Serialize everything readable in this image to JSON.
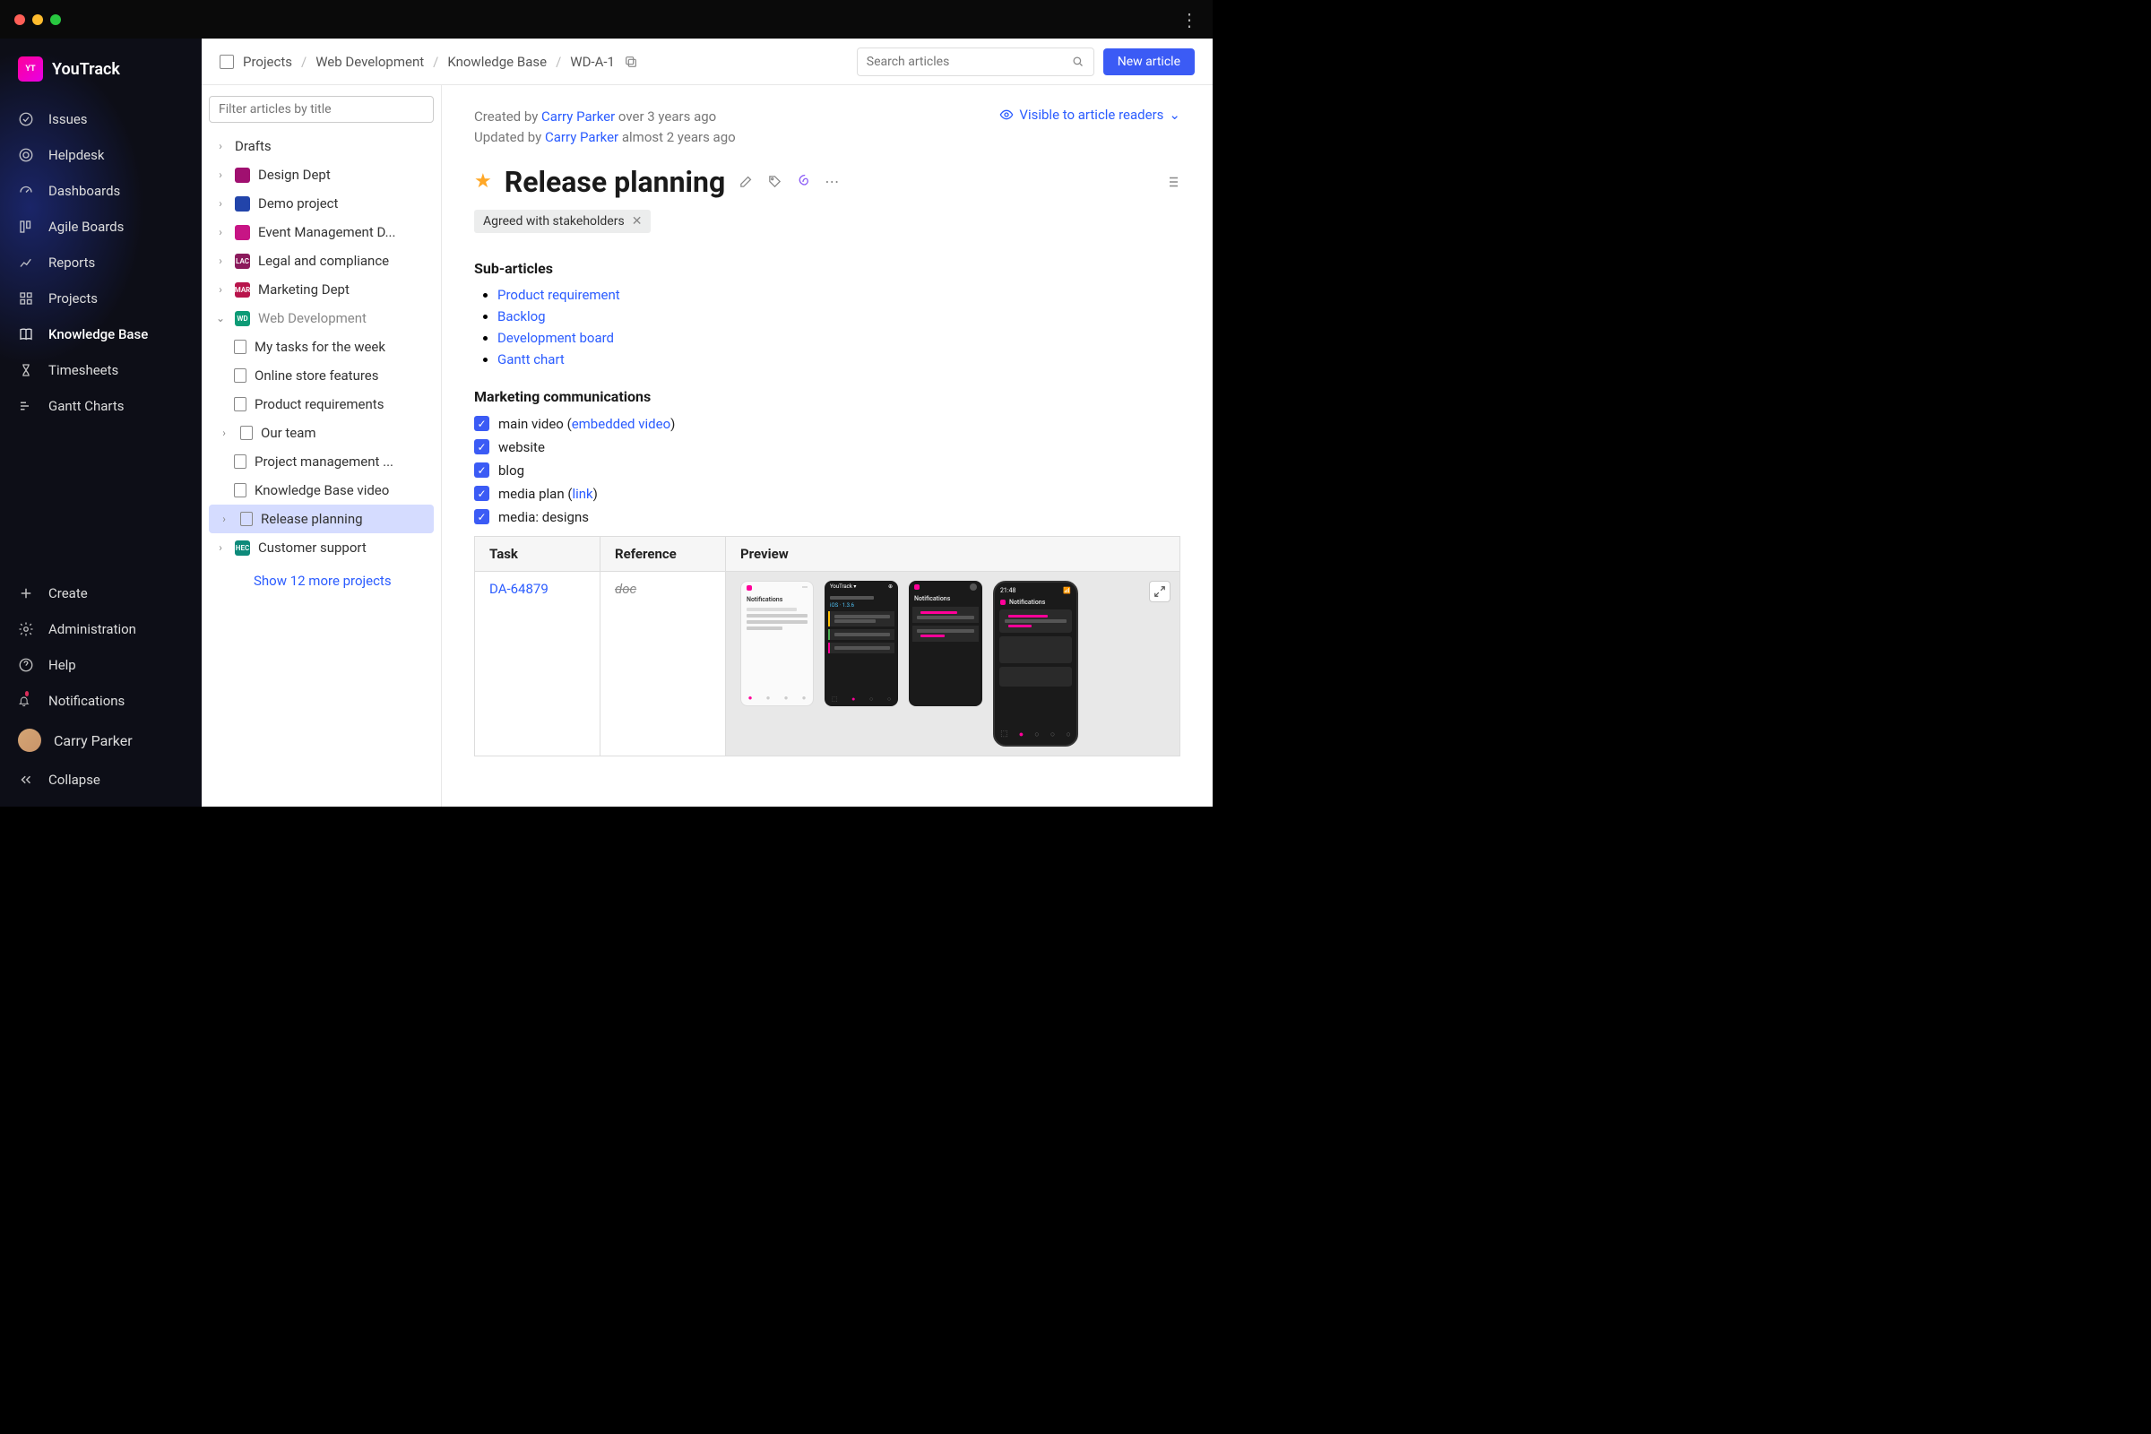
{
  "app": {
    "name": "YouTrack",
    "logo_badge": "YT"
  },
  "sidebar": {
    "items": [
      {
        "label": "Issues",
        "icon": "check-circle"
      },
      {
        "label": "Helpdesk",
        "icon": "lifebuoy"
      },
      {
        "label": "Dashboards",
        "icon": "speedometer"
      },
      {
        "label": "Agile Boards",
        "icon": "board"
      },
      {
        "label": "Reports",
        "icon": "chart-line"
      },
      {
        "label": "Projects",
        "icon": "grid"
      },
      {
        "label": "Knowledge Base",
        "icon": "book",
        "active": true
      },
      {
        "label": "Timesheets",
        "icon": "hourglass"
      },
      {
        "label": "Gantt Charts",
        "icon": "gantt"
      }
    ],
    "bottom": [
      {
        "label": "Create",
        "icon": "plus"
      },
      {
        "label": "Administration",
        "icon": "gear"
      },
      {
        "label": "Help",
        "icon": "question"
      },
      {
        "label": "Notifications",
        "icon": "bell",
        "dot": true
      }
    ],
    "user": {
      "name": "Carry Parker"
    },
    "collapse": "Collapse"
  },
  "breadcrumb": {
    "items": [
      "Projects",
      "Web Development",
      "Knowledge Base",
      "WD-A-1"
    ]
  },
  "search": {
    "placeholder": "Search articles"
  },
  "new_article_btn": "New article",
  "tree": {
    "filter_placeholder": "Filter articles by title",
    "items": [
      {
        "label": "Drafts",
        "type": "folder"
      },
      {
        "label": "Design Dept",
        "type": "project",
        "color": "#a01070"
      },
      {
        "label": "Demo project",
        "type": "project",
        "color": "#2244aa"
      },
      {
        "label": "Event Management D...",
        "type": "project",
        "color": "#c71585"
      },
      {
        "label": "Legal and compliance",
        "type": "project",
        "color": "#8b1a5c",
        "badge": "LAC"
      },
      {
        "label": "Marketing Dept",
        "type": "project",
        "color": "#b8144b",
        "badge": "MAR"
      },
      {
        "label": "Web Development",
        "type": "project",
        "color": "#0d9b76",
        "badge": "WD",
        "expanded": true,
        "muted": true
      },
      {
        "label": "My tasks for the week",
        "type": "doc",
        "child": true
      },
      {
        "label": "Online store features",
        "type": "doc",
        "child": true
      },
      {
        "label": "Product requirements",
        "type": "doc",
        "child": true
      },
      {
        "label": "Our team",
        "type": "doc",
        "child": true,
        "haschev": true
      },
      {
        "label": "Project management ...",
        "type": "doc",
        "child": true,
        "locked": true
      },
      {
        "label": "Knowledge Base video",
        "type": "doc",
        "child": true
      },
      {
        "label": "Release planning",
        "type": "doc",
        "child": true,
        "selected": true,
        "haschev": true
      },
      {
        "label": "Customer support",
        "type": "project",
        "color": "#0d8a7a",
        "badge": "HEC"
      }
    ],
    "show_more": "Show 12 more projects"
  },
  "article": {
    "created_prefix": "Created by ",
    "created_by": "Carry Parker",
    "created_ago": " over 3 years ago",
    "updated_prefix": "Updated by ",
    "updated_by": "Carry Parker",
    "updated_ago": " almost 2 years ago",
    "visibility": "Visible to article readers",
    "title": "Release planning",
    "tag": "Agreed with stakeholders",
    "sub_heading": "Sub-articles",
    "sub_articles": [
      "Product requirement",
      "Backlog",
      "Development board",
      "Gantt chart"
    ],
    "marketing_heading": "Marketing communications",
    "checklist": [
      {
        "text_before": "main video (",
        "link": "embedded video",
        "text_after": ")"
      },
      {
        "text_before": "website"
      },
      {
        "text_before": "blog"
      },
      {
        "text_before": "media plan (",
        "link": "link",
        "text_after": ")"
      },
      {
        "text_before": "media: designs"
      }
    ],
    "table": {
      "headers": [
        "Task",
        "Reference",
        "Preview"
      ],
      "task_id": "DA-64879",
      "reference": "doc"
    }
  }
}
